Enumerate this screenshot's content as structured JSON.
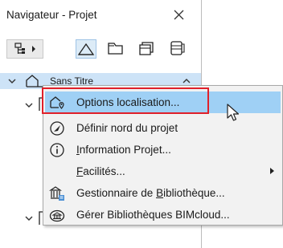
{
  "window": {
    "title": "Navigateur - Projet"
  },
  "toolbar": {
    "icons": [
      "project-map-icon",
      "view-map-icon",
      "layout-book-icon",
      "publisher-sets-icon"
    ]
  },
  "tree": {
    "root_label": "Sans Titre"
  },
  "context_menu": {
    "items": [
      {
        "label": "Options localisation...",
        "icon": "location-options-icon",
        "selected": true
      },
      {
        "label": "Définir nord du projet",
        "icon": "compass-icon",
        "selected": false
      },
      {
        "label_prefix": "",
        "label_accel": "I",
        "label_rest": "nformation Projet...",
        "icon": "info-icon",
        "selected": false
      },
      {
        "label_prefix": "",
        "label_accel": "F",
        "label_rest": "acilités...",
        "icon": "",
        "selected": false,
        "has_submenu": true
      },
      {
        "label_prefix": "Gestionnaire de ",
        "label_accel": "B",
        "label_rest": "ibliothèque...",
        "icon": "library-manager-icon",
        "selected": false
      },
      {
        "label": "Gérer Bibliothèques BIMcloud...",
        "icon": "bimcloud-library-icon",
        "selected": false
      }
    ]
  },
  "colors": {
    "selection": "#9fd0f5",
    "highlight_box": "#e0202a",
    "tree_selection": "#cde3f7"
  }
}
